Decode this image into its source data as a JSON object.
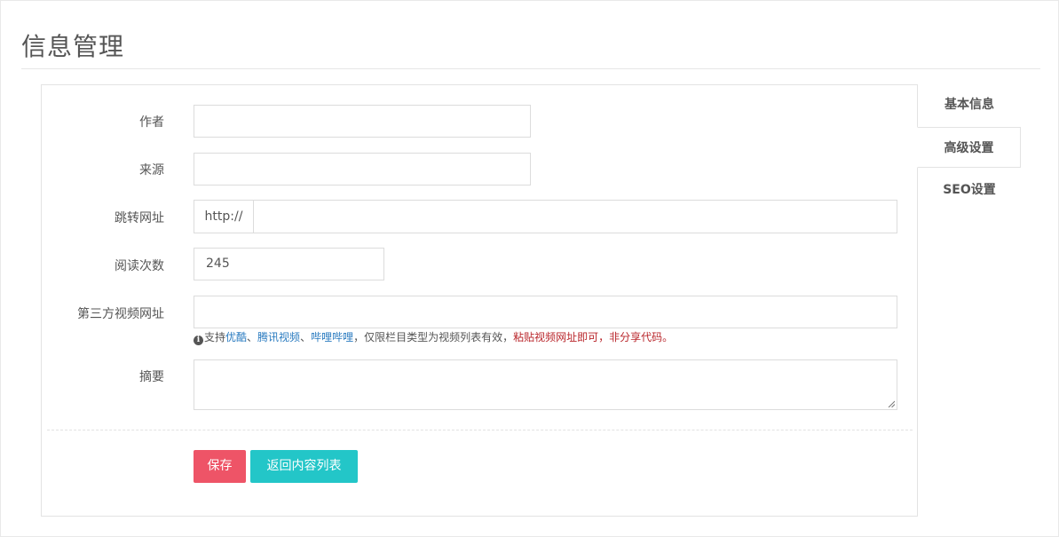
{
  "page": {
    "title": "信息管理"
  },
  "form": {
    "author": {
      "label": "作者",
      "value": ""
    },
    "source": {
      "label": "来源",
      "value": ""
    },
    "redirect_url": {
      "label": "跳转网址",
      "prefix": "http://",
      "value": ""
    },
    "read_count": {
      "label": "阅读次数",
      "value": "245"
    },
    "video_url": {
      "label": "第三方视频网址",
      "value": "",
      "hint": {
        "icon": "info-circle-icon",
        "prefix": "支持",
        "site1": "优酷",
        "sep1": "、",
        "site2": "腾讯视频",
        "sep2": "、",
        "site3": "哔哩哔哩",
        "middle": "，仅限栏目类型为视频列表有效，",
        "warning": "粘贴视频网址即可，非分享代码。"
      }
    },
    "summary": {
      "label": "摘要",
      "value": ""
    }
  },
  "actions": {
    "save_label": "保存",
    "back_label": "返回内容列表"
  },
  "tabs": [
    {
      "label": "基本信息",
      "active": false
    },
    {
      "label": "高级设置",
      "active": true
    },
    {
      "label": "SEO设置",
      "active": false
    }
  ],
  "colors": {
    "save_button": "#ee5467",
    "back_button": "#23c6c8",
    "link": "#2a7bc0",
    "warning": "#b9262b"
  }
}
